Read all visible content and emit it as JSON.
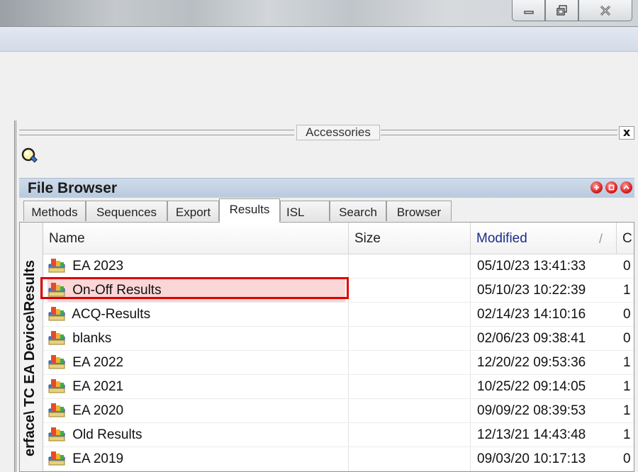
{
  "window": {
    "controls": [
      {
        "name": "minimize",
        "icon": "minimize-icon"
      },
      {
        "name": "maximize",
        "icon": "restore-icon"
      },
      {
        "name": "close",
        "icon": "close-icon"
      }
    ]
  },
  "accessories": {
    "title": "Accessories",
    "close_label": "x",
    "tool_icon": "search-icon"
  },
  "file_browser": {
    "title": "File Browser",
    "tabs": [
      {
        "label": "Methods"
      },
      {
        "label": "Sequences"
      },
      {
        "label": "Export"
      },
      {
        "label": "Results",
        "active": true
      },
      {
        "label": "ISL"
      },
      {
        "label": "Search"
      },
      {
        "label": "Browser"
      }
    ],
    "path_vertical": "erface\\ TC EA Device\\Results",
    "columns": {
      "name": "Name",
      "size": "Size",
      "modified": "Modified",
      "sort_marker": "/",
      "extra": "C"
    },
    "rows": [
      {
        "name": "EA 2023",
        "size": "",
        "modified": "05/10/23 13:41:33",
        "extra": "0"
      },
      {
        "name": "On-Off Results",
        "size": "",
        "modified": "05/10/23 10:22:39",
        "extra": "1",
        "selected": true
      },
      {
        "name": "ACQ-Results",
        "size": "",
        "modified": "02/14/23 14:10:16",
        "extra": "0"
      },
      {
        "name": "blanks",
        "size": "",
        "modified": "02/06/23 09:38:41",
        "extra": "0"
      },
      {
        "name": "EA 2022",
        "size": "",
        "modified": "12/20/22 09:53:36",
        "extra": "1"
      },
      {
        "name": "EA 2021",
        "size": "",
        "modified": "10/25/22 09:14:05",
        "extra": "1"
      },
      {
        "name": "EA 2020",
        "size": "",
        "modified": "09/09/22 08:39:53",
        "extra": "1"
      },
      {
        "name": "Old Results",
        "size": "",
        "modified": "12/13/21 14:43:48",
        "extra": "1"
      },
      {
        "name": "EA 2019",
        "size": "",
        "modified": "09/03/20 10:17:13",
        "extra": "0"
      }
    ],
    "header_controls": [
      "add-icon",
      "stop-icon",
      "collapse-icon"
    ],
    "colors": {
      "highlight": "#e00000",
      "selected_bg": "#fbd6d6",
      "modified_header": "#1d2c8c"
    }
  }
}
